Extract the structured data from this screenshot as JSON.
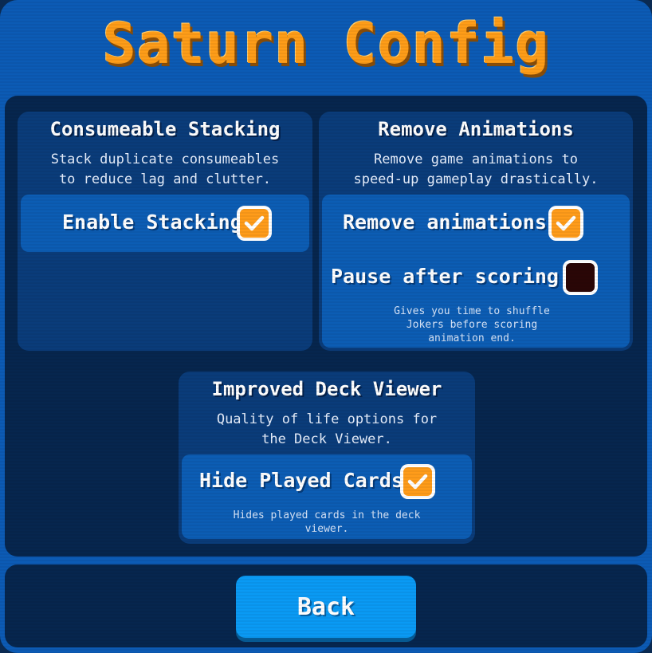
{
  "title": "Saturn Config",
  "sections": {
    "stacking": {
      "title": "Consumeable Stacking",
      "desc_line1": "Stack duplicate consumeables",
      "desc_line2": "to reduce lag and clutter.",
      "option_label": "Enable Stacking",
      "option_checked": true
    },
    "animations": {
      "title": "Remove Animations",
      "desc_line1": "Remove game animations to",
      "desc_line2": "speed-up gameplay drastically.",
      "remove_label": "Remove animations",
      "remove_checked": true,
      "pause_label": "Pause after scoring",
      "pause_checked": false,
      "pause_hint_line1": "Gives you time to shuffle",
      "pause_hint_line2": "Jokers before scoring",
      "pause_hint_line3": "animation end."
    },
    "deck_viewer": {
      "title": "Improved Deck Viewer",
      "desc_line1": "Quality of life options for",
      "desc_line2": "the Deck Viewer.",
      "hide_label": "Hide Played Cards",
      "hide_checked": true,
      "hide_hint_line1": "Hides played cards in the deck",
      "hide_hint_line2": "viewer."
    }
  },
  "back_label": "Back",
  "colors": {
    "accent_orange": "#fe9d18",
    "checkbox_on": "#ff9c1a",
    "checkbox_off": "#2a0606",
    "back_button": "#0a9af4"
  }
}
